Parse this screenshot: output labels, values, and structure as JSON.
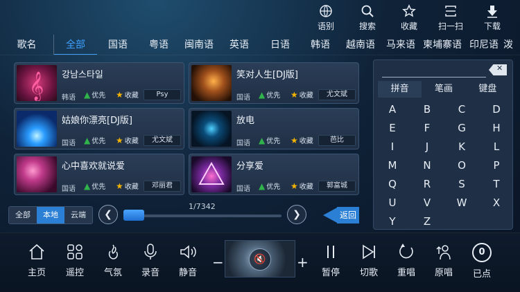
{
  "toolbar": [
    {
      "label": "语别",
      "icon": "globe-icon"
    },
    {
      "label": "搜索",
      "icon": "search-icon"
    },
    {
      "label": "收藏",
      "icon": "star-icon"
    },
    {
      "label": "扫一扫",
      "icon": "scan-icon"
    },
    {
      "label": "下载",
      "icon": "download-icon"
    }
  ],
  "categories": {
    "first": "歌名",
    "items": [
      "全部",
      "国语",
      "粤语",
      "闽南语",
      "英语",
      "日语",
      "韩语",
      "越南语",
      "马来语",
      "柬埔寨语",
      "印尼语",
      "泼"
    ]
  },
  "songs": [
    {
      "title": "강남스타일",
      "lang": "韩语",
      "priority": "优先",
      "favorite": "收藏",
      "singer": "Psy"
    },
    {
      "title": "笑对人生[DJ版]",
      "lang": "国语",
      "priority": "优先",
      "favorite": "收藏",
      "singer": "尤文斌"
    },
    {
      "title": "姑娘你漂亮[DJ版]",
      "lang": "国语",
      "priority": "优先",
      "favorite": "收藏",
      "singer": "尤文斌"
    },
    {
      "title": "放电",
      "lang": "国语",
      "priority": "优先",
      "favorite": "收藏",
      "singer": "芭比"
    },
    {
      "title": "心中喜欢就说爱",
      "lang": "国语",
      "priority": "优先",
      "favorite": "收藏",
      "singer": "邓丽君"
    },
    {
      "title": "分享爱",
      "lang": "国语",
      "priority": "优先",
      "favorite": "收藏",
      "singer": "郭富城"
    }
  ],
  "keyboard": {
    "tabs": [
      "拼音",
      "笔画",
      "键盘"
    ],
    "keys": [
      "A",
      "B",
      "C",
      "D",
      "E",
      "F",
      "G",
      "H",
      "I",
      "J",
      "K",
      "L",
      "M",
      "N",
      "O",
      "P",
      "Q",
      "R",
      "S",
      "T",
      "U",
      "V",
      "W",
      "X",
      "Y",
      "Z"
    ]
  },
  "filter": [
    "全部",
    "本地",
    "云端"
  ],
  "pager": {
    "text": "1/7342",
    "progress": 0.0
  },
  "back_label": "返回",
  "bottom": {
    "left": [
      {
        "label": "主页",
        "icon": "home-icon"
      },
      {
        "label": "遥控",
        "icon": "remote-icon"
      },
      {
        "label": "气氛",
        "icon": "atmosphere-icon"
      },
      {
        "label": "录音",
        "icon": "microphone-icon"
      },
      {
        "label": "静音",
        "icon": "mute-icon"
      }
    ],
    "vol_minus": "−",
    "vol_plus": "+",
    "right": [
      {
        "label": "暂停",
        "icon": "pause-icon"
      },
      {
        "label": "切歌",
        "icon": "next-icon"
      },
      {
        "label": "重唱",
        "icon": "replay-icon"
      },
      {
        "label": "原唱",
        "icon": "original-singer-icon"
      },
      {
        "label": "已点",
        "badge": "0"
      }
    ]
  }
}
